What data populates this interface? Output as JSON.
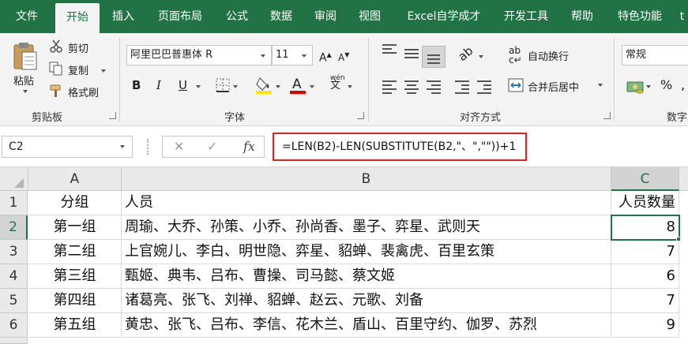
{
  "tabs": [
    "文件",
    "开始",
    "插入",
    "页面布局",
    "公式",
    "数据",
    "审阅",
    "视图",
    "Excel自学成才",
    "开发工具",
    "帮助",
    "特色功能",
    "t"
  ],
  "ribbon": {
    "clipboard": {
      "label": "剪贴板",
      "paste": "粘贴",
      "cut": "剪切",
      "copy": "复制",
      "format_painter": "格式刷"
    },
    "font": {
      "label": "字体",
      "font_name": "阿里巴巴普惠体 R",
      "font_size": "11",
      "bold": "B",
      "italic": "I",
      "underline": "U",
      "font_color_glyph": "A",
      "phonetic_glyph": "wén"
    },
    "alignment": {
      "label": "对齐方式",
      "wrap_text": "自动换行",
      "merge_center": "合并后居中"
    },
    "number": {
      "label": "数字",
      "format": "常规",
      "percent": "%"
    }
  },
  "formula_bar": {
    "name_box": "C2",
    "cancel": "✕",
    "enter": "✓",
    "fx": "fx",
    "formula": "=LEN(B2)-LEN(SUBSTITUTE(B2,\"、\",\"\"))+1"
  },
  "sheet": {
    "columns": [
      "A",
      "B",
      "C"
    ],
    "rows": [
      {
        "num": "1",
        "a": "分组",
        "b": "人员",
        "c": "人员数量"
      },
      {
        "num": "2",
        "a": "第一组",
        "b": "周瑜、大乔、孙策、小乔、孙尚香、墨子、弈星、武则天",
        "c": "8"
      },
      {
        "num": "3",
        "a": "第二组",
        "b": "上官婉儿、李白、明世隐、弈星、貂蝉、裴禽虎、百里玄策",
        "c": "7"
      },
      {
        "num": "4",
        "a": "第三组",
        "b": "甄姬、典韦、吕布、曹操、司马懿、蔡文姬",
        "c": "6"
      },
      {
        "num": "5",
        "a": "第四组",
        "b": "诸葛亮、张飞、刘禅、貂蝉、赵云、元歌、刘备",
        "c": "7"
      },
      {
        "num": "6",
        "a": "第五组",
        "b": "黄忠、张飞、吕布、李信、花木兰、盾山、百里守约、伽罗、苏烈",
        "c": "9"
      }
    ]
  },
  "colors": {
    "brand": "#217346",
    "highlight_border": "#e02020",
    "fill_yellow": "#ffe500",
    "font_red": "#e00000"
  }
}
